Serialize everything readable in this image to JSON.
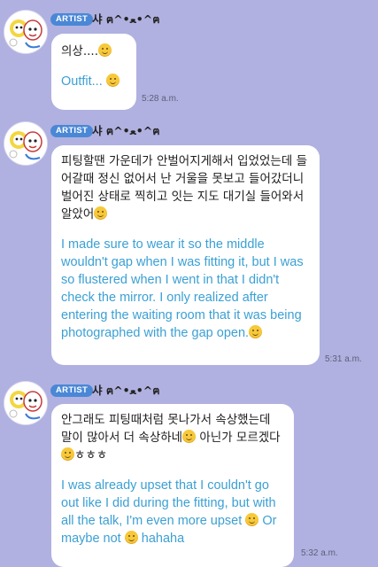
{
  "messages": [
    {
      "badge": "ARTIST",
      "sender": "샤 ฅ^•ﻌ•^ฅ",
      "korean": "의상....",
      "english": "Outfit... ",
      "time": "5:28 a.m."
    },
    {
      "badge": "ARTIST",
      "sender": "샤 ฅ^•ﻌ•^ฅ",
      "korean": "피팅할땐 가운데가 안벌어지게해서 입었었는데 들어갈때 정신 없어서 난 거울을 못보고 들어갔더니 벌어진 상태로 찍히고 잇는 지도 대기실 들어와서 알았어",
      "english": "I made sure to wear it so the middle wouldn't gap when I was fitting it, but I was so flustered when I went in that I didn't check the mirror. I only realized after entering the waiting room that it was being photographed with the gap open.",
      "time": "5:31 a.m."
    },
    {
      "badge": "ARTIST",
      "sender": "샤 ฅ^•ﻌ•^ฅ",
      "korean_part1": "안그래도 피팅때처럼 못나가서 속상했는데 말이 많아서 더 속상하네",
      "korean_part2": " 아닌가 모르겠다",
      "korean_part3": "ㅎㅎㅎ",
      "english_part1": "I was already upset that I couldn't go out like I did during the fitting, but with all the talk, I'm even more upset ",
      "english_part2": " Or maybe not ",
      "english_part3": " hahaha",
      "time": "5:32 a.m."
    }
  ],
  "icons": {
    "avatar": "cartoon-character-avatar",
    "emoji": "smiling-face-emoji"
  },
  "colors": {
    "background": "#b0b1e0",
    "badge": "#4a88d6",
    "english_text": "#3ba0d4",
    "bubble": "#ffffff"
  }
}
